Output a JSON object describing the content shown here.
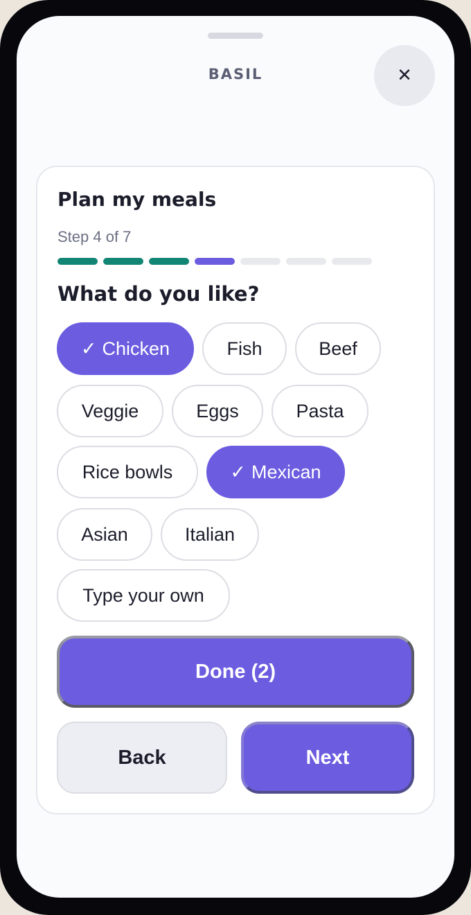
{
  "app": {
    "brand": "BASIL",
    "close_glyph": "✕"
  },
  "planner": {
    "title": "Plan my meals",
    "step_label": "Step 4 of 7",
    "progress": {
      "current_step": 4,
      "total_steps": 7
    },
    "question": "What do you like?",
    "chips": [
      {
        "label": "Chicken",
        "selected": true
      },
      {
        "label": "Fish",
        "selected": false
      },
      {
        "label": "Beef",
        "selected": false
      },
      {
        "label": "Veggie",
        "selected": false
      },
      {
        "label": "Eggs",
        "selected": false
      },
      {
        "label": "Pasta",
        "selected": false
      },
      {
        "label": "Rice bowls",
        "selected": false
      },
      {
        "label": "Mexican",
        "selected": true
      },
      {
        "label": "Asian",
        "selected": false
      },
      {
        "label": "Italian",
        "selected": false
      },
      {
        "label": "Type your own",
        "selected": false
      }
    ],
    "check_glyph": "✓",
    "done_label": "Done (2)",
    "back_label": "Back",
    "next_label": "Next"
  },
  "colors": {
    "accent": "#6b5ce0",
    "progress_done": "#138574",
    "progress_empty": "#e8e9ed",
    "frame": "#07070c"
  }
}
